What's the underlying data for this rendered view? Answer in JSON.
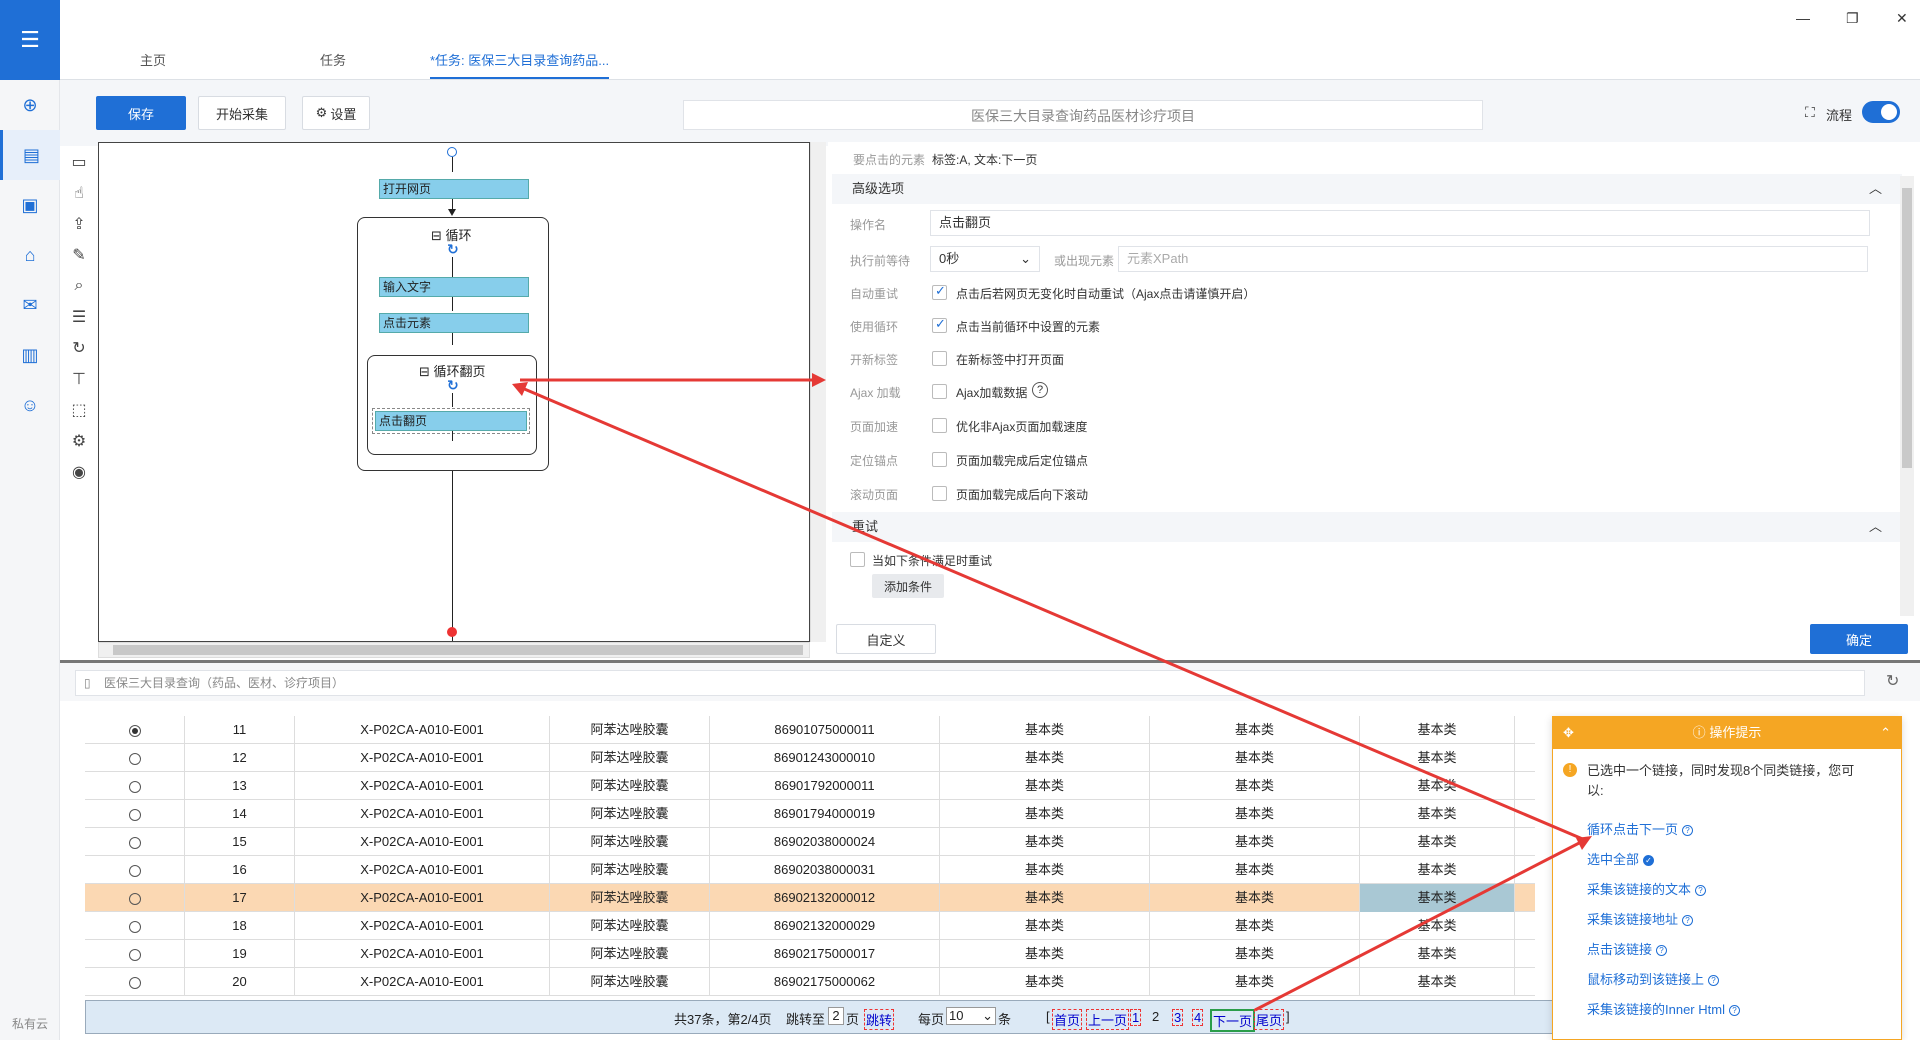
{
  "nav": {
    "footer": "私有云"
  },
  "window": {
    "minimize": "—",
    "restore": "❐",
    "close": "✕"
  },
  "tabs": [
    "主页",
    "任务",
    "*任务: 医保三大目录查询药品..."
  ],
  "toolbar": {
    "save": "保存",
    "start_collect": "开始采集",
    "settings": "设置",
    "task_name": "医保三大目录查询药品医材诊疗项目",
    "flow": "流程"
  },
  "flow": {
    "open_page": "打开网页",
    "loop": "循环",
    "input_text": "输入文字",
    "click_element": "点击元素",
    "loop_paging": "循环翻页",
    "click_paging": "点击翻页"
  },
  "settings": {
    "target_label": "要点击的元素",
    "target_value": "标签:A, 文本:下一页",
    "advanced": "高级选项",
    "op_name_label": "操作名",
    "op_name_value": "点击翻页",
    "wait_label": "执行前等待",
    "wait_value": "0秒",
    "or_appear_label": "或出现元素",
    "xpath_placeholder": "元素XPath",
    "auto_retry_label": "自动重试",
    "auto_retry_text": "点击后若网页无变化时自动重试（Ajax点击请谨慎开启）",
    "use_loop_label": "使用循环",
    "use_loop_text": "点击当前循环中设置的元素",
    "new_tab_label": "开新标签",
    "new_tab_text": "在新标签中打开页面",
    "ajax_label": "Ajax 加载",
    "ajax_text": "Ajax加载数据",
    "speed_label": "页面加速",
    "speed_text": "优化非Ajax页面加载速度",
    "anchor_label": "定位锚点",
    "anchor_text": "页面加载完成后定位锚点",
    "scroll_label": "滚动页面",
    "scroll_text": "页面加载完成后向下滚动",
    "retry_section": "重试",
    "retry_cond": "当如下条件满足时重试",
    "add_cond": "添加条件",
    "custom": "自定义",
    "ok": "确定"
  },
  "browser": {
    "url": "医保三大目录查询（药品、医材、诊疗项目）"
  },
  "table": {
    "rows": [
      {
        "idx": "11",
        "code": "X-P02CA-A010-E001",
        "name": "阿苯达唑胶囊",
        "num": "86901075000011",
        "a": "基本类",
        "b": "基本类",
        "c": "基本类",
        "selected": true
      },
      {
        "idx": "12",
        "code": "X-P02CA-A010-E001",
        "name": "阿苯达唑胶囊",
        "num": "86901243000010",
        "a": "基本类",
        "b": "基本类",
        "c": "基本类"
      },
      {
        "idx": "13",
        "code": "X-P02CA-A010-E001",
        "name": "阿苯达唑胶囊",
        "num": "86901792000011",
        "a": "基本类",
        "b": "基本类",
        "c": "基本类"
      },
      {
        "idx": "14",
        "code": "X-P02CA-A010-E001",
        "name": "阿苯达唑胶囊",
        "num": "86901794000019",
        "a": "基本类",
        "b": "基本类",
        "c": "基本类"
      },
      {
        "idx": "15",
        "code": "X-P02CA-A010-E001",
        "name": "阿苯达唑胶囊",
        "num": "86902038000024",
        "a": "基本类",
        "b": "基本类",
        "c": "基本类"
      },
      {
        "idx": "16",
        "code": "X-P02CA-A010-E001",
        "name": "阿苯达唑胶囊",
        "num": "86902038000031",
        "a": "基本类",
        "b": "基本类",
        "c": "基本类"
      },
      {
        "idx": "17",
        "code": "X-P02CA-A010-E001",
        "name": "阿苯达唑胶囊",
        "num": "86902132000012",
        "a": "基本类",
        "b": "基本类",
        "c": "基本类",
        "highlight": true
      },
      {
        "idx": "18",
        "code": "X-P02CA-A010-E001",
        "name": "阿苯达唑胶囊",
        "num": "86902132000029",
        "a": "基本类",
        "b": "基本类",
        "c": "基本类"
      },
      {
        "idx": "19",
        "code": "X-P02CA-A010-E001",
        "name": "阿苯达唑胶囊",
        "num": "86902175000017",
        "a": "基本类",
        "b": "基本类",
        "c": "基本类"
      },
      {
        "idx": "20",
        "code": "X-P02CA-A010-E001",
        "name": "阿苯达唑胶囊",
        "num": "86902175000062",
        "a": "基本类",
        "b": "基本类",
        "c": "基本类"
      }
    ]
  },
  "pager": {
    "summary": "共37条，第2/4页",
    "jump_to": "跳转至",
    "jump_value": "2",
    "page_unit": "页",
    "jump": "跳转",
    "per_page": "每页",
    "per_value": "10",
    "per_unit": "条",
    "first": "首页",
    "prev": "上一页",
    "p1": "1",
    "p2": "2",
    "p3": "3",
    "p4": "4",
    "next": "下一页",
    "last": "尾页"
  },
  "popup": {
    "title": "操作提示",
    "message": "已选中一个链接，同时发现8个同类链接，您可以:",
    "items": [
      "循环点击下一页",
      "选中全部",
      "采集该链接的文本",
      "采集该链接地址",
      "点击该链接",
      "鼠标移动到该链接上",
      "采集该链接的Inner Html"
    ]
  },
  "colors": {
    "accent": "#1f6fd6",
    "popup": "#f5a623",
    "highlight_row": "#fbd8b3",
    "arrow": "#e53935"
  }
}
